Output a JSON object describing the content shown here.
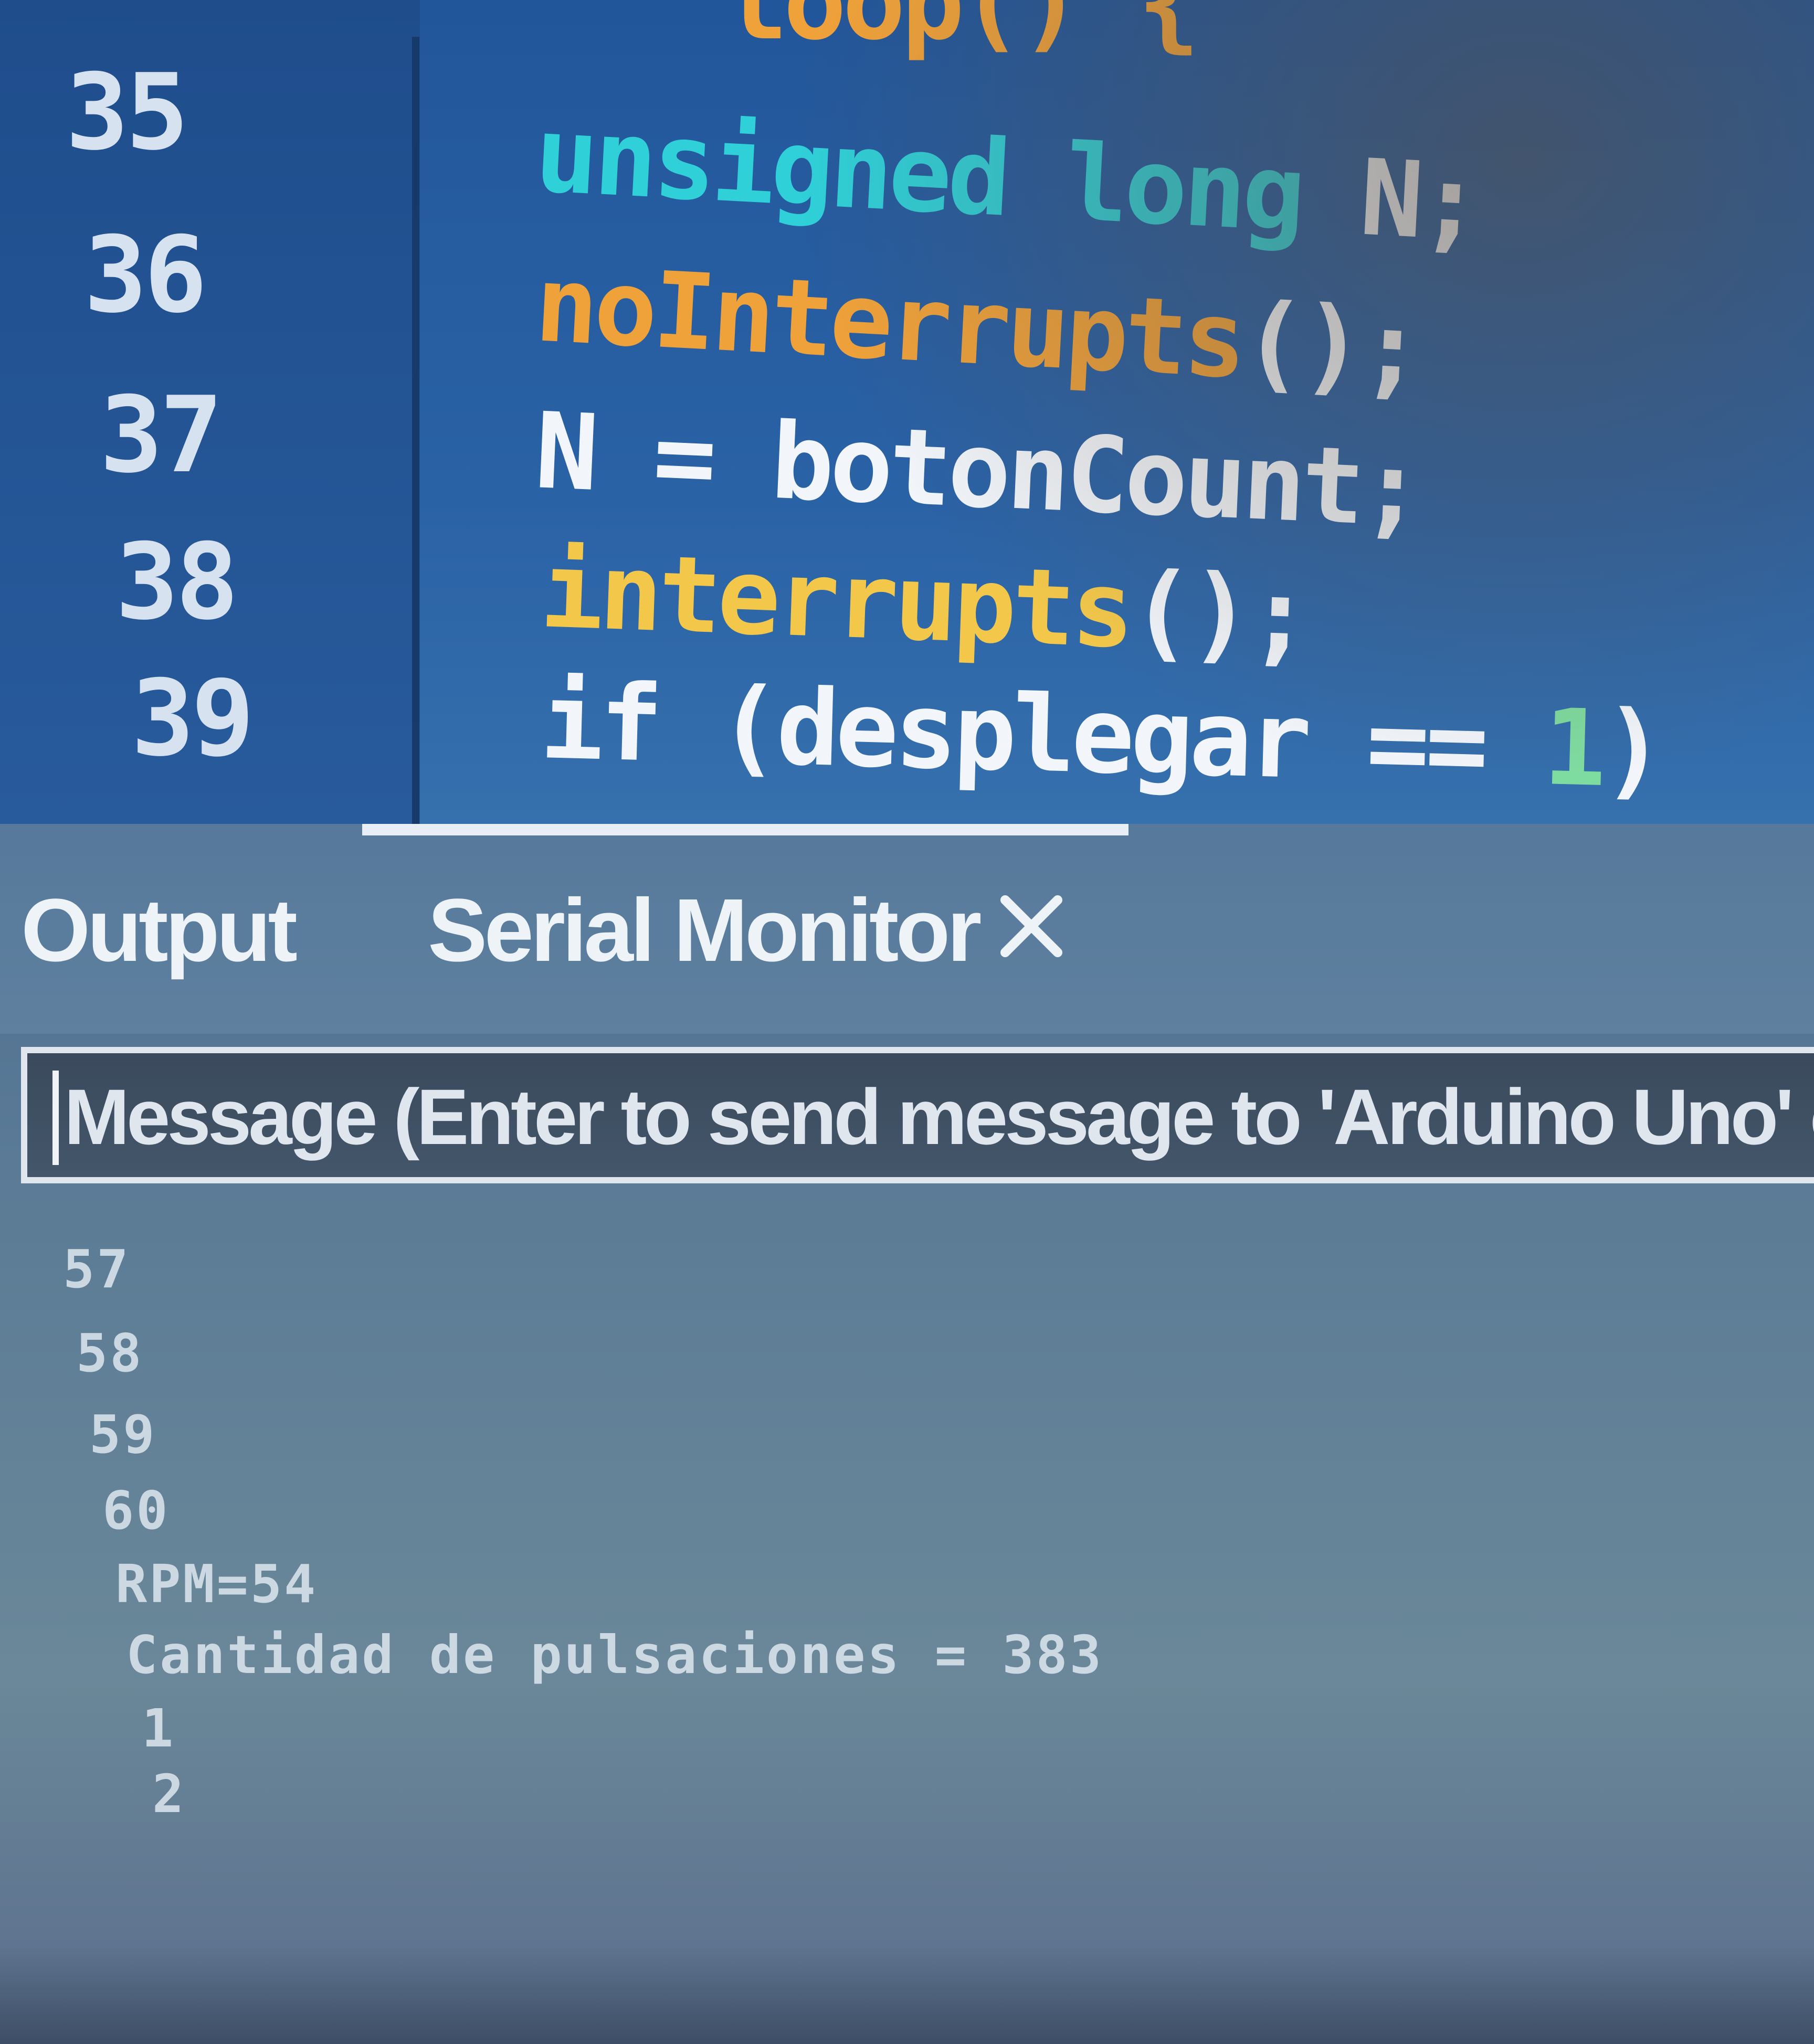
{
  "editor": {
    "line_numbers": [
      "35",
      "36",
      "37",
      "38",
      "39"
    ],
    "lines": [
      {
        "partial_top": "loop() {"
      },
      {
        "t1": "unsigned long",
        "t2": " N;"
      },
      {
        "t1": "noInterrupts",
        "t2": "();"
      },
      {
        "t1": "N = botonCount;"
      },
      {
        "t1": "interrupts",
        "t2": "();"
      },
      {
        "t1": "if (desplegar == ",
        "t2": "1",
        "t3": ")"
      }
    ],
    "colors": {
      "keyword": "#2fd0d8",
      "function_orange": "#f0a23a",
      "function_yellow": "#f3c84a",
      "number": "#7fdca0",
      "text": "#f2f6fb"
    }
  },
  "panel": {
    "tabs": [
      {
        "label": "Output"
      },
      {
        "label": "Serial Monitor"
      }
    ],
    "close_icon": "close-icon",
    "message_input": {
      "placeholder": "Message (Enter to send message to 'Arduino Uno' on"
    },
    "serial_lines": [
      "57",
      "58",
      "59",
      "60",
      "RPM=54",
      "Cantidad de pulsaciones = 383",
      "1",
      "2"
    ]
  }
}
